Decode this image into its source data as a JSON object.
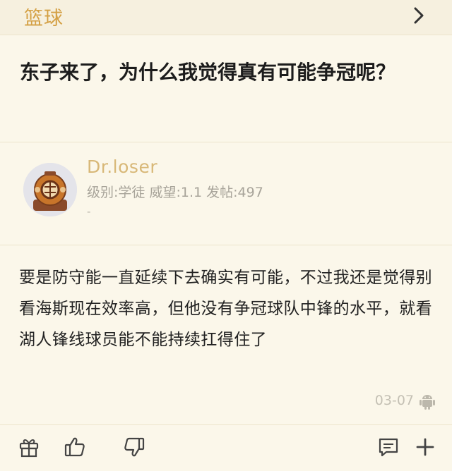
{
  "header": {
    "section": "篮球",
    "forward_icon": "chevron-right-icon"
  },
  "post": {
    "title": "东子来了，为什么我觉得真有可能争冠呢？",
    "author": {
      "name": "Dr.loser",
      "level_label": "级别:学徒",
      "reputation_label": "威望:1.1",
      "posts_label": "发帖:497",
      "signature": "-",
      "avatar_icon": "diving-helmet-avatar"
    },
    "content": "要是防守能一直延续下去确实有可能，不过我还是觉得别看海斯现在效率高，但他没有争冠球队中锋的水平，就看湖人锋线球员能不能持续扛得住了",
    "date": "03-07",
    "client_icon": "android-icon"
  },
  "actions": {
    "gift_icon": "gift-icon",
    "like_icon": "thumbs-up-icon",
    "dislike_icon": "thumbs-down-icon",
    "comment_icon": "comment-icon",
    "more_icon": "plus-icon"
  },
  "colors": {
    "background": "#fbf7ea",
    "accent": "#d4a044",
    "username": "#d8b878"
  }
}
